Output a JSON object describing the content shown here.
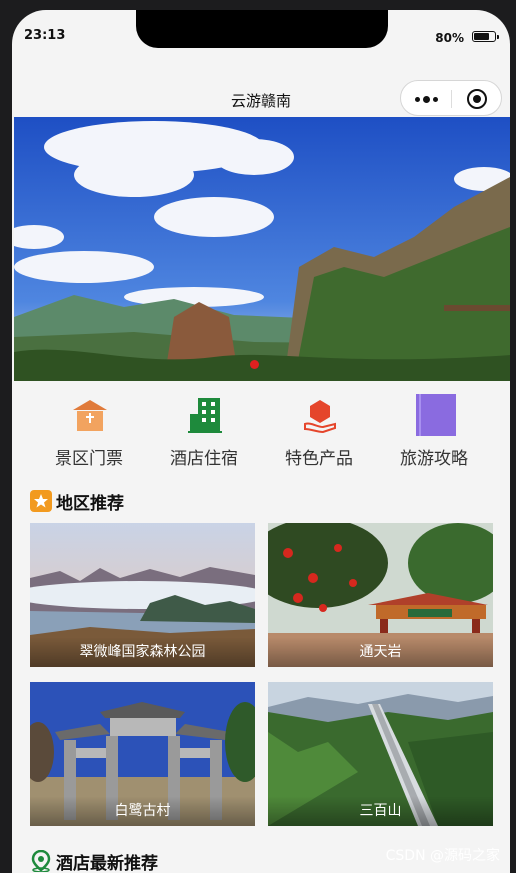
{
  "status": {
    "time": "23:13",
    "battery": "80%",
    "battery_level": 0.8
  },
  "navbar": {
    "title": "云游赣南",
    "menu_icon": "more-dots-icon",
    "close_icon": "target-circle-icon"
  },
  "banner": {
    "slides_indicator_active": 0
  },
  "categories": [
    {
      "label": "景区门票",
      "icon": "ticket-building-icon",
      "color": "#e07a3a"
    },
    {
      "label": "酒店住宿",
      "icon": "hotel-building-icon",
      "color": "#1e8a3c"
    },
    {
      "label": "特色产品",
      "icon": "product-hand-icon",
      "color": "#e5452b"
    },
    {
      "label": "旅游攻略",
      "icon": "guide-book-icon",
      "color": "#8a6be0"
    }
  ],
  "region_section": {
    "title": "地区推荐",
    "icon": "star-badge-icon"
  },
  "regions": [
    {
      "name": "翠微峰国家森林公园"
    },
    {
      "name": "通天岩"
    },
    {
      "name": "白鹭古村"
    },
    {
      "name": "三百山"
    }
  ],
  "hotel_section": {
    "title": "酒店最新推荐",
    "icon": "location-pin-icon"
  },
  "watermark": "CSDN @源码之家"
}
